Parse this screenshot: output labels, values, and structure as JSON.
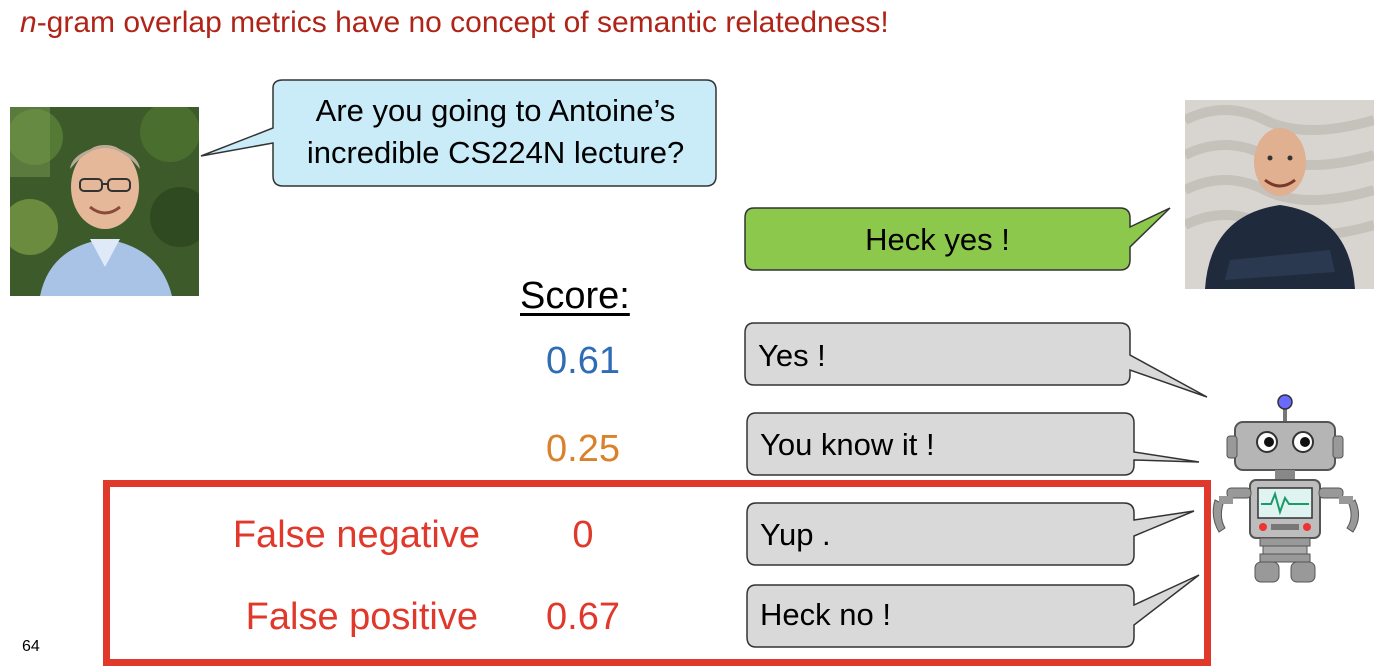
{
  "slide": {
    "title_italic": "n",
    "title_rest": "-gram overlap metrics have no concept of semantic relatedness!",
    "page_number": "64"
  },
  "dialogue": {
    "question_line1": "Are you going to Antoine’s",
    "question_line2": "incredible CS224N lecture?",
    "reference_answer": "Heck yes !"
  },
  "scores": {
    "header": "Score:",
    "rows": [
      {
        "response": "Yes !",
        "score": "0.61",
        "color": "#2e6db4",
        "label": ""
      },
      {
        "response": "You know it !",
        "score": "0.25",
        "color": "#d9822b",
        "label": ""
      },
      {
        "response": "Yup .",
        "score": "0",
        "color": "#e0392b",
        "label": "False negative"
      },
      {
        "response": "Heck no !",
        "score": "0.67",
        "color": "#e0392b",
        "label": "False positive"
      }
    ]
  },
  "colors": {
    "title": "#b02418",
    "question_bubble": "#c9ecf8",
    "reference_bubble": "#8cc84b",
    "response_bubble": "#d9d9d9",
    "highlight_box": "#e0392b"
  },
  "icons": {
    "left_person": "person-photo-icon",
    "right_person": "person-photo-icon",
    "robot": "robot-icon"
  }
}
